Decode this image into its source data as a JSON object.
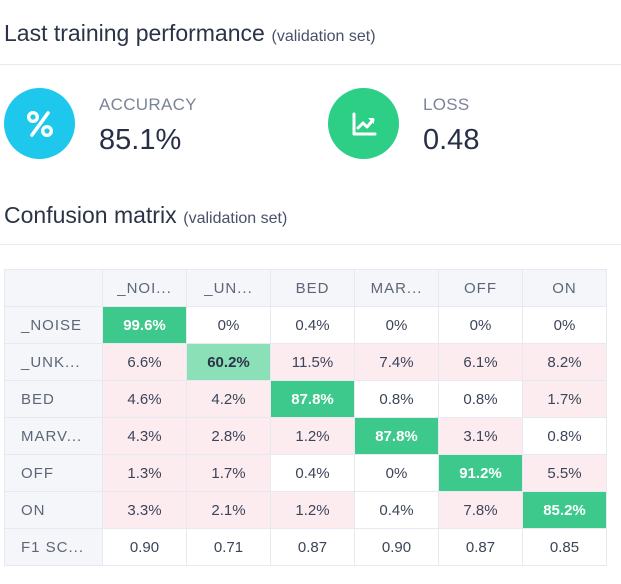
{
  "performance": {
    "title": "Last training performance",
    "subtitle": "(validation set)",
    "metrics": [
      {
        "label": "ACCURACY",
        "value": "85.1%",
        "icon": "percent-icon",
        "color": "#1ec8ec"
      },
      {
        "label": "LOSS",
        "value": "0.48",
        "icon": "trending-up-chart-icon",
        "color": "#2dcf86"
      }
    ]
  },
  "confusion": {
    "title": "Confusion matrix",
    "subtitle": "(validation set)",
    "columns": [
      "_NOI...",
      "_UN...",
      "BED",
      "MAR...",
      "OFF",
      "ON"
    ],
    "rows": [
      {
        "label": "_NOISE",
        "cells": [
          "99.6%",
          "0%",
          "0.4%",
          "0%",
          "0%",
          "0%"
        ]
      },
      {
        "label": "_UNK...",
        "cells": [
          "6.6%",
          "60.2%",
          "11.5%",
          "7.4%",
          "6.1%",
          "8.2%"
        ]
      },
      {
        "label": "BED",
        "cells": [
          "4.6%",
          "4.2%",
          "87.8%",
          "0.8%",
          "0.8%",
          "1.7%"
        ]
      },
      {
        "label": "MARV...",
        "cells": [
          "4.3%",
          "2.8%",
          "1.2%",
          "87.8%",
          "3.1%",
          "0.8%"
        ]
      },
      {
        "label": "OFF",
        "cells": [
          "1.3%",
          "1.7%",
          "0.4%",
          "0%",
          "91.2%",
          "5.5%"
        ]
      },
      {
        "label": "ON",
        "cells": [
          "3.3%",
          "2.1%",
          "1.2%",
          "0.4%",
          "7.8%",
          "85.2%"
        ]
      }
    ],
    "f1": {
      "label": "F1 SC...",
      "cells": [
        "0.90",
        "0.71",
        "0.87",
        "0.90",
        "0.87",
        "0.85"
      ]
    },
    "colors": {
      "diag_strong": "#3cc98b",
      "diag_mid": "#8ce0b8",
      "offdiag_tint": "#fcecef"
    }
  }
}
